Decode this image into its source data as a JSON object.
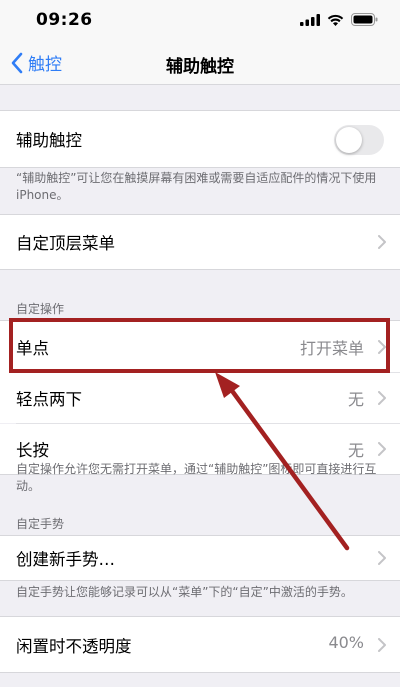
{
  "status_bar": {
    "time": "09:26"
  },
  "nav": {
    "back_label": "触控",
    "title": "辅助触控"
  },
  "assistive_touch": {
    "label": "辅助触控",
    "enabled": false,
    "description": "“辅助触控”可让您在触摸屏幕有困难或需要自适应配件的情况下使用iPhone。"
  },
  "top_menu": {
    "label": "自定顶层菜单"
  },
  "custom_actions": {
    "header": "自定操作",
    "items": [
      {
        "label": "单点",
        "value": "打开菜单"
      },
      {
        "label": "轻点两下",
        "value": "无"
      },
      {
        "label": "长按",
        "value": "无"
      }
    ],
    "description": "自定操作允许您无需打开菜单，通过“辅助触控”图标即可直接进行互动。"
  },
  "custom_gestures": {
    "header": "自定手势",
    "create_label": "创建新手势…",
    "description": "自定手势让您能够记录可以从“菜单”下的“自定”中激活的手势。"
  },
  "idle_opacity": {
    "label": "闲置时不透明度",
    "value": "40%"
  },
  "colors": {
    "accent": "#2f7df6",
    "highlight": "#a32121"
  }
}
